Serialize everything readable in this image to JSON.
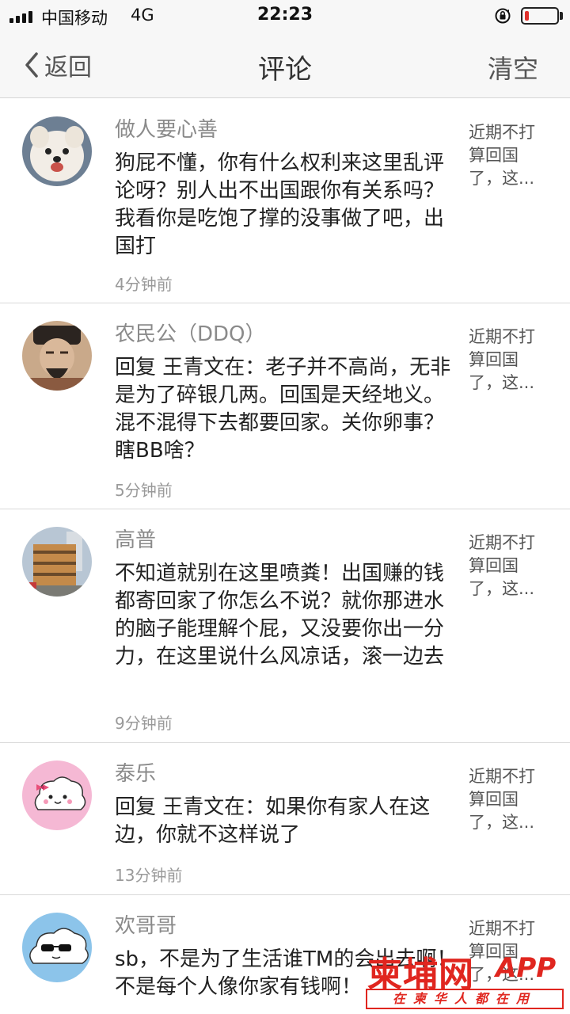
{
  "status_bar": {
    "carrier": "中国移动",
    "network": "4G",
    "time": "22:23",
    "battery_level": 0.12,
    "battery_color": "#e0312d"
  },
  "nav": {
    "back_label": "返回",
    "title": "评论",
    "clear_label": "清空",
    "back_icon": "chevron-left-icon"
  },
  "comments": [
    {
      "author": "做人要心善",
      "text": "狗屁不懂，你有什么权利来这里乱评论呀？别人出不出国跟你有关系吗？我看你是吃饱了撑的没事做了吧，出国打",
      "time": "4分钟前",
      "snippet": "近期不打算回国了，这...",
      "avatar": "white-puppy"
    },
    {
      "author": "农民公（DDQ）",
      "text": "回复 王青文在：老子并不高尚，无非是为了碎银几两。回国是天经地义。混不混得下去都要回家。关你卵事？瞎BB啥？",
      "time": "5分钟前",
      "snippet": "近期不打算回国了，这...",
      "avatar": "ancient-portrait"
    },
    {
      "author": "高普",
      "text": "不知道就别在这里喷粪！出国赚的钱都寄回家了你怎么不说？就你那进水的脑子能理解个屁，又没要你出一分力，在这里说什么风凉话，滚一边去",
      "time": "9分钟前",
      "snippet": "近期不打算回国了，这...",
      "avatar": "building-photo"
    },
    {
      "author": "泰乐",
      "text": "回复 王青文在：如果你有家人在这边，你就不这样说了",
      "time": "13分钟前",
      "snippet": "近期不打算回国了，这...",
      "avatar": "cartoon-cloud-bow"
    },
    {
      "author": "欢哥哥",
      "text": "sb，不是为了生活谁TM的会出去啊！不是每个人像你家有钱啊！",
      "time": "",
      "snippet": "近期不打算回国了，这...",
      "avatar": "cartoon-cloud-sunglasses"
    }
  ],
  "watermark": {
    "logo": "柬埔网",
    "app": "APP",
    "slogan": "在柬华人都在用"
  }
}
